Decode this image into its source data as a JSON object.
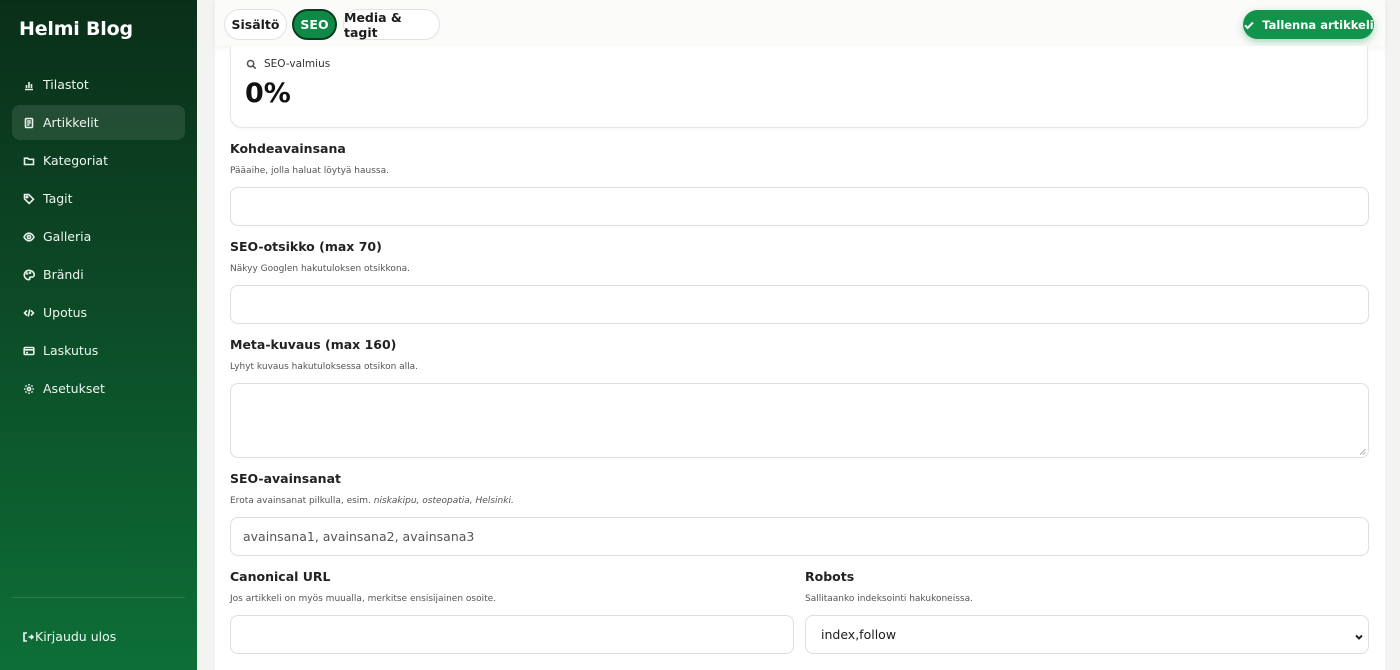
{
  "sidebar": {
    "brand": "Helmi Blog",
    "items": [
      {
        "label": "Tilastot",
        "icon": "bar-chart-icon"
      },
      {
        "label": "Artikkelit",
        "icon": "document-icon"
      },
      {
        "label": "Kategoriat",
        "icon": "folder-icon"
      },
      {
        "label": "Tagit",
        "icon": "tag-icon"
      },
      {
        "label": "Galleria",
        "icon": "eye-icon"
      },
      {
        "label": "Brändi",
        "icon": "palette-icon"
      },
      {
        "label": "Upotus",
        "icon": "code-icon"
      },
      {
        "label": "Laskutus",
        "icon": "credit-card-icon"
      },
      {
        "label": "Asetukset",
        "icon": "gear-icon"
      }
    ],
    "active_item": "Artikkelit",
    "logout": "Kirjaudu ulos"
  },
  "tabs": [
    {
      "label": "Sisältö"
    },
    {
      "label": "SEO"
    },
    {
      "label": "Media & tagit"
    }
  ],
  "active_tab": "SEO",
  "save_button": "Tallenna artikkeli",
  "seo_readiness": {
    "label": "SEO-valmius",
    "value": "0%"
  },
  "fields": {
    "keyword": {
      "label": "Kohdeavainsana",
      "help": "Pääaihe, jolla haluat löytyä haussa.",
      "value": ""
    },
    "seo_title": {
      "label": "SEO-otsikko (max 70)",
      "help": "Näkyy Googlen hakutuloksen otsikkona.",
      "value": ""
    },
    "meta_description": {
      "label": "Meta-kuvaus (max 160)",
      "help": "Lyhyt kuvaus hakutuloksessa otsikon alla.",
      "value": ""
    },
    "seo_keywords": {
      "label": "SEO-avainsanat",
      "help_prefix": "Erota avainsanat pilkulla, esim.",
      "help_example": "niskakipu, osteopatia, Helsinki.",
      "placeholder": "avainsana1, avainsana2, avainsana3"
    },
    "canonical": {
      "label": "Canonical URL",
      "help": "Jos artikkeli on myös muualla, merkitse ensisijainen osoite.",
      "value": ""
    },
    "robots": {
      "label": "Robots",
      "help": "Sallitaanko indeksointi hakukoneissa.",
      "value": "index,follow"
    }
  },
  "colors": {
    "accent": "#12934b",
    "sidebar_dark": "#0a2f19",
    "sidebar_light": "#0d6f37"
  }
}
